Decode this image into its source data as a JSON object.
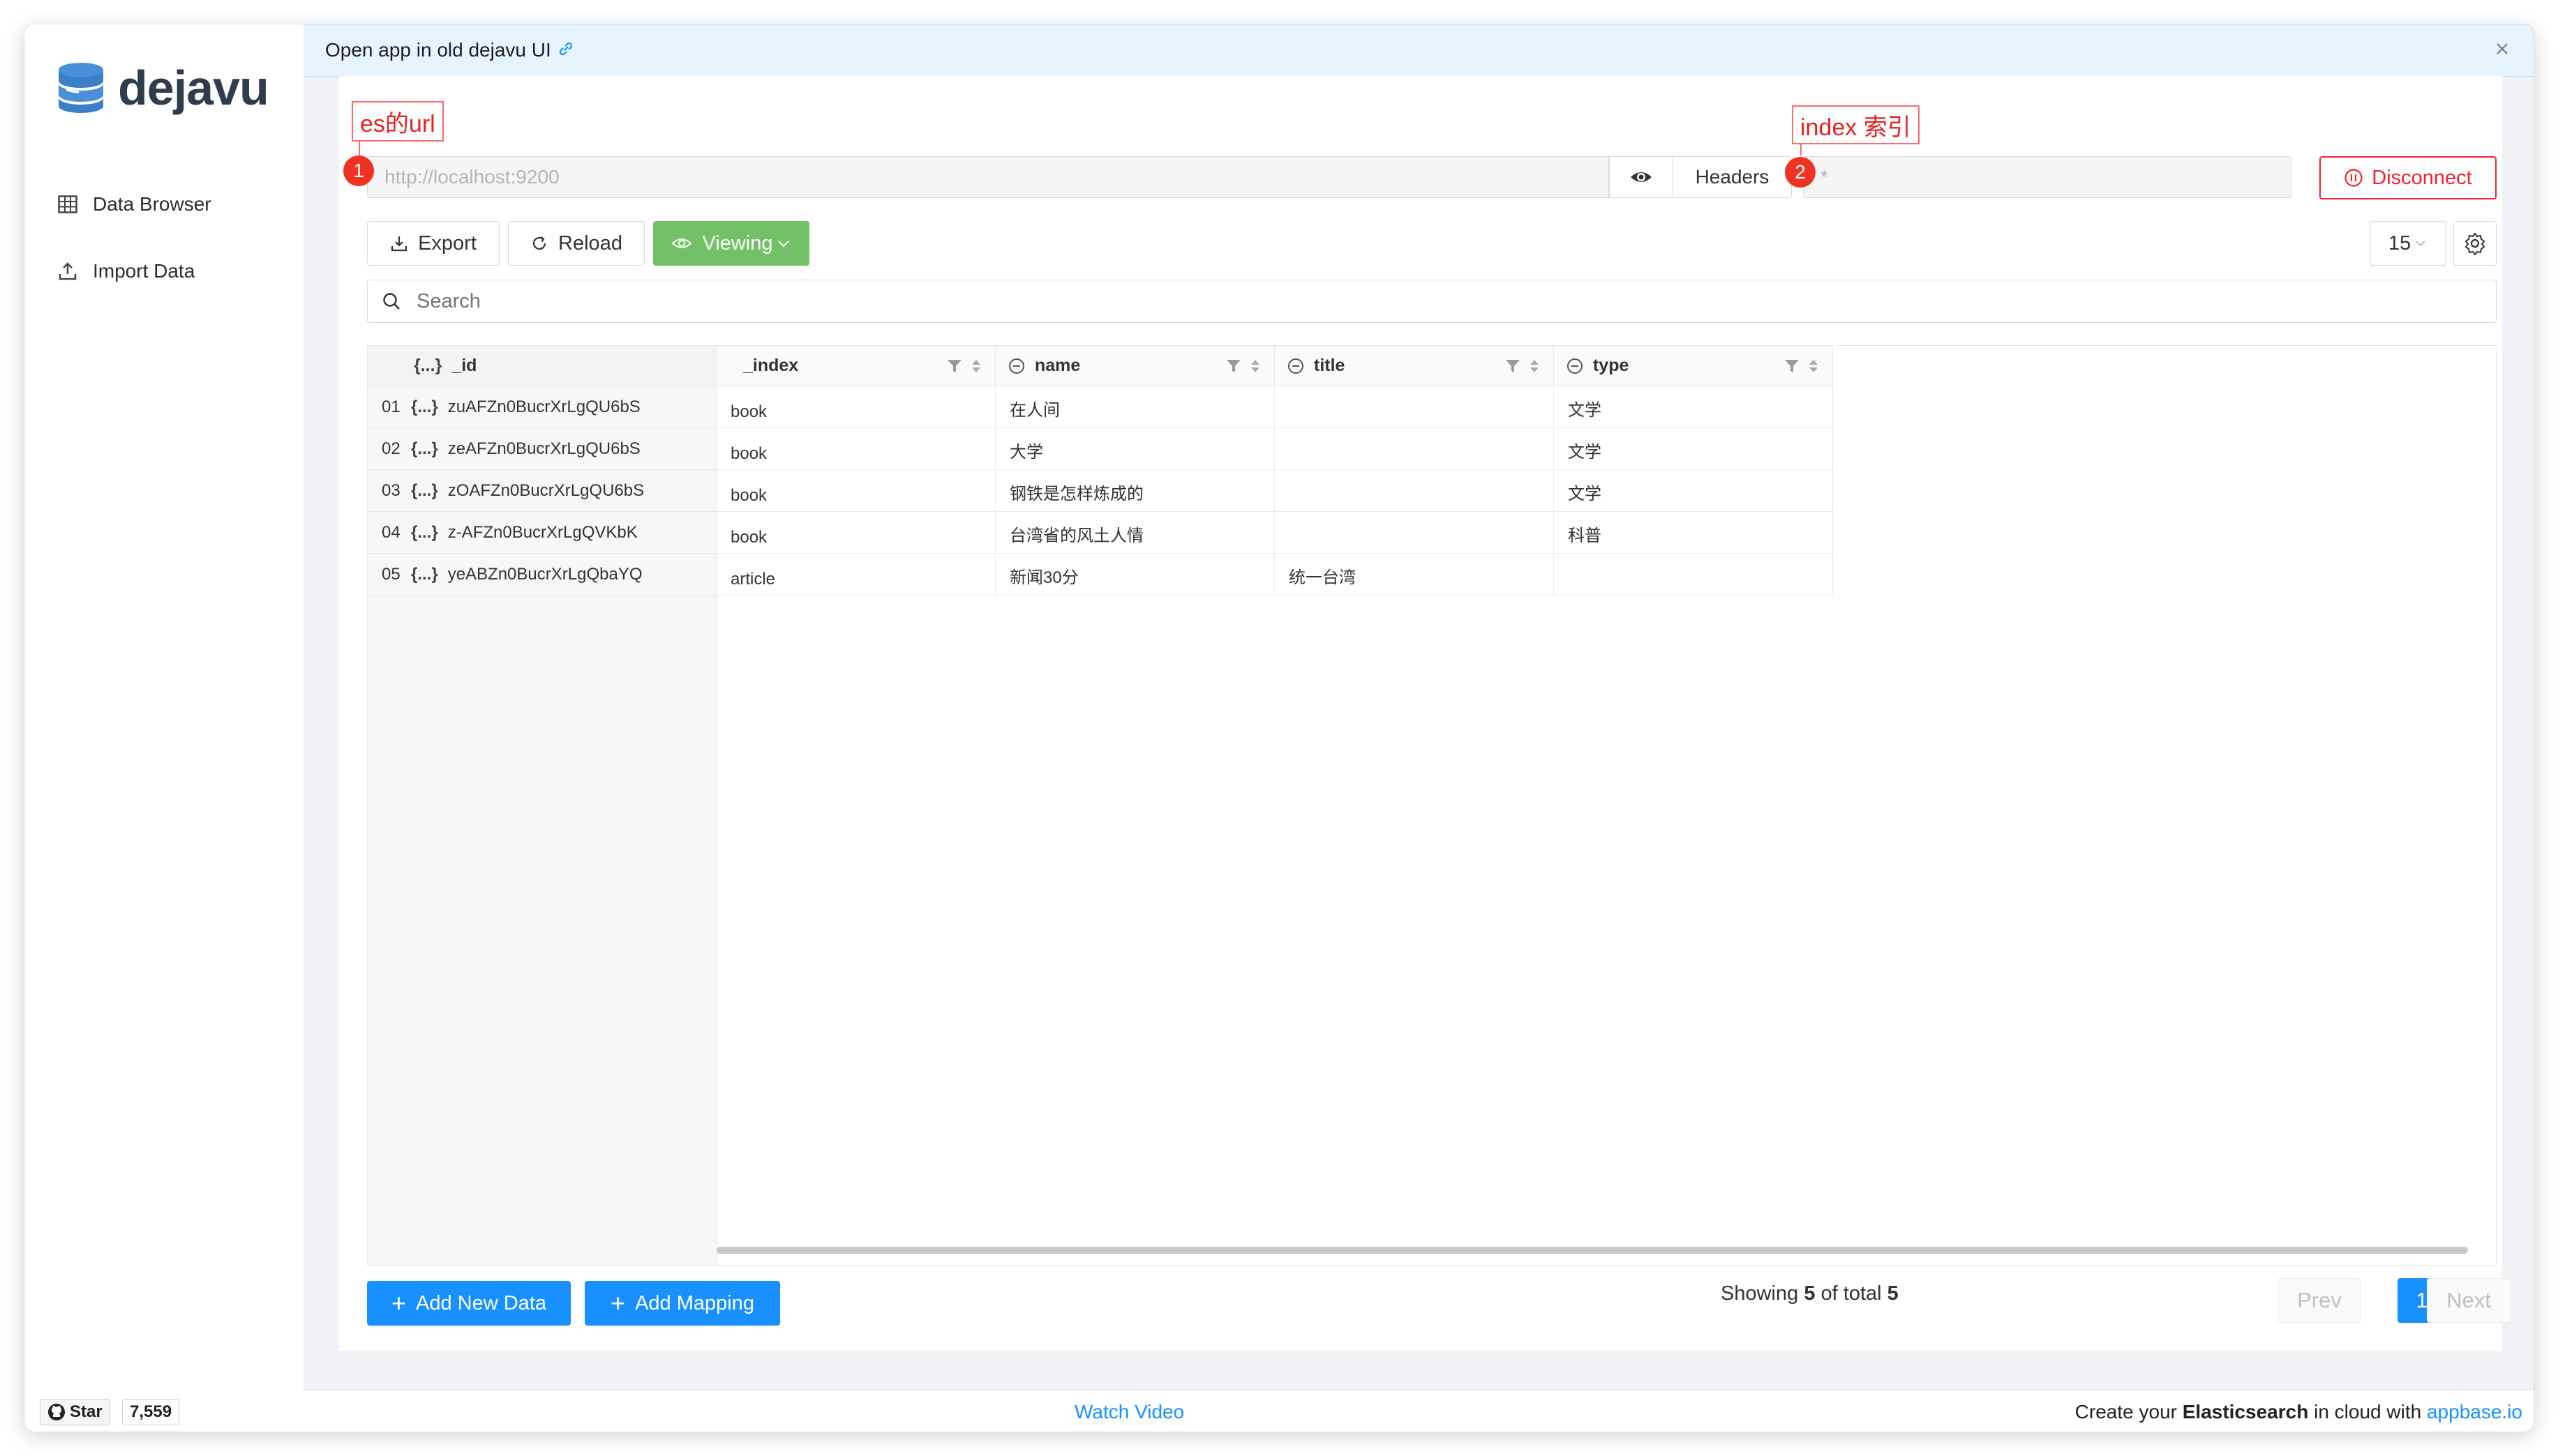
{
  "app": {
    "logo_text": "dejavu"
  },
  "sidebar": {
    "items": [
      {
        "label": "Data Browser",
        "icon": "table-icon"
      },
      {
        "label": "Import Data",
        "icon": "upload-icon"
      }
    ]
  },
  "banner": {
    "text": "Open app in old dejavu UI",
    "link_icon": "link-icon",
    "close_icon": "close-icon"
  },
  "connection": {
    "url_placeholder": "http://localhost:9200",
    "headers_label": "Headers",
    "index_placeholder": "*",
    "disconnect_label": "Disconnect"
  },
  "annotations": {
    "url": {
      "number": "1",
      "label": "es的url"
    },
    "index": {
      "number": "2",
      "label": "index 索引"
    }
  },
  "toolbar": {
    "export_label": "Export",
    "reload_label": "Reload",
    "viewing_label": "Viewing",
    "page_size": "15"
  },
  "search": {
    "placeholder": "Search"
  },
  "table": {
    "id_header": "_id",
    "id_header_brace": "{...}",
    "columns": [
      "_index",
      "name",
      "title",
      "type"
    ],
    "rows": [
      {
        "num": "01",
        "brace": "{...}",
        "id": "zuAFZn0BucrXrLgQU6bS",
        "index": "book",
        "name": "在人间",
        "title": "",
        "type": "文学"
      },
      {
        "num": "02",
        "brace": "{...}",
        "id": "zeAFZn0BucrXrLgQU6bS",
        "index": "book",
        "name": "大学",
        "title": "",
        "type": "文学"
      },
      {
        "num": "03",
        "brace": "{...}",
        "id": "zOAFZn0BucrXrLgQU6bS",
        "index": "book",
        "name": "钢铁是怎样炼成的",
        "title": "",
        "type": "文学"
      },
      {
        "num": "04",
        "brace": "{...}",
        "id": "z-AFZn0BucrXrLgQVKbK",
        "index": "book",
        "name": "台湾省的风土人情",
        "title": "",
        "type": "科普"
      },
      {
        "num": "05",
        "brace": "{...}",
        "id": "yeABZn0BucrXrLgQbaYQ",
        "index": "article",
        "name": "新闻30分",
        "title": "统一台湾",
        "type": ""
      }
    ]
  },
  "footer": {
    "add_data_label": "Add New Data",
    "add_mapping_label": "Add Mapping",
    "showing_prefix": "Showing",
    "showing_count": "5",
    "showing_mid": "of total",
    "showing_total": "5",
    "prev_label": "Prev",
    "current_page": "1",
    "next_label": "Next"
  },
  "bottombar": {
    "star_label": "Star",
    "star_count": "7,559",
    "watch_video": "Watch Video",
    "cloud_prefix": "Create your",
    "cloud_bold": "Elasticsearch",
    "cloud_mid": "in cloud with",
    "cloud_link": "appbase.io"
  },
  "colors": {
    "accent": "#1890ff",
    "viewing_green": "#73c166",
    "disconnect_red": "#f5222d",
    "annotation_red": "#ee3322",
    "banner_bg": "#e6f4ff"
  }
}
